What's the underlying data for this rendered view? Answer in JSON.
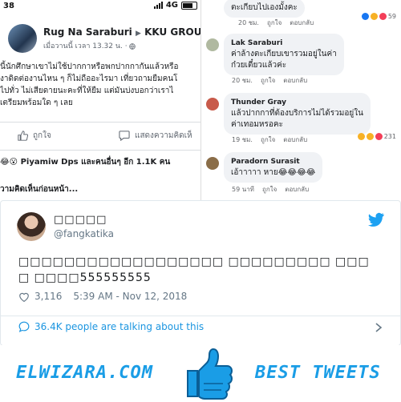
{
  "facebook": {
    "status_time": "38",
    "status_network": "4G",
    "post": {
      "author": "Rug Na Saraburi",
      "arrow": "▶",
      "group": "KKU GROUP",
      "meta": "เมื่อวานนี้ เวลา 13.32 น. ·",
      "lines": [
        "นี้นักศึกษาเขาไม่ใช้ปากกาหรือพกปากกากันแล้วหรือ",
        "งาดิดต่องานไหน ๆ ก็ไม่ถืออะไรมา  เที่ยวถามยืมคนโ",
        "ไปทั่ว  ไม่เสียดายนะคะที่ให้ยืม  แต่มันบ่งบอกว่าเราไ",
        "เตรียมพร้อมใด ๆ เลย"
      ],
      "like_label": "ถูกใจ",
      "comment_label": "แสดงความคิดเห็",
      "reactions_text": "Piyamiw Dps และคนอื่นๆ อีก 1.1K คน",
      "previous_comments": "วามคิดเห็นก่อนหน้า..."
    },
    "comments": [
      {
        "author": "",
        "text": "ตะเกียบไปเองมั้งคะ",
        "time": "20 ชม.",
        "like": "ถูกใจ",
        "reply": "ตอบกลับ",
        "count": "59"
      },
      {
        "author": "Lak Saraburi",
        "text_lines": [
          "ค่าล้างตะเกียบเขารวมอยู่ในค่า",
          "ก๋วยเตี๋ยวแล้วค่ะ"
        ],
        "time": "20 ชม.",
        "like": "ถูกใจ",
        "reply": "ตอบกลับ"
      },
      {
        "author": "Thunder Gray",
        "text_lines": [
          "แล้วปากกาที่ต้องบริการไม่ได้รวมอยู่ใน",
          "ค่าเทอมหรอคะ"
        ],
        "time": "19 ชม.",
        "like": "ถูกใจ",
        "reply": "ตอบกลับ",
        "count": "231"
      },
      {
        "author": "Paradorn Surasit",
        "text": "เอ้าาาาา หาย😂😂😂😂",
        "time": "59 นาที",
        "like": "ถูกใจ",
        "reply": "ตอบกลับ"
      }
    ]
  },
  "tweet": {
    "display_name": "□□□□□",
    "handle": "@fangkatika",
    "text": "□□□□□□□□□□□□□□□□□□ □□□□□□□□□ □□□□ □□□□555555555",
    "likes": "3,116",
    "timestamp": "5:39 AM - Nov 12, 2018",
    "talking": "36.4K people are talking about this"
  },
  "banner": {
    "left": "ELWIZARA.COM",
    "right": "BEST TWEETS"
  },
  "colors": {
    "twitter_blue": "#1da1f2",
    "link_blue": "#1b95e0",
    "banner_blue": "#1a9de6",
    "like_red": "#e0245e"
  }
}
